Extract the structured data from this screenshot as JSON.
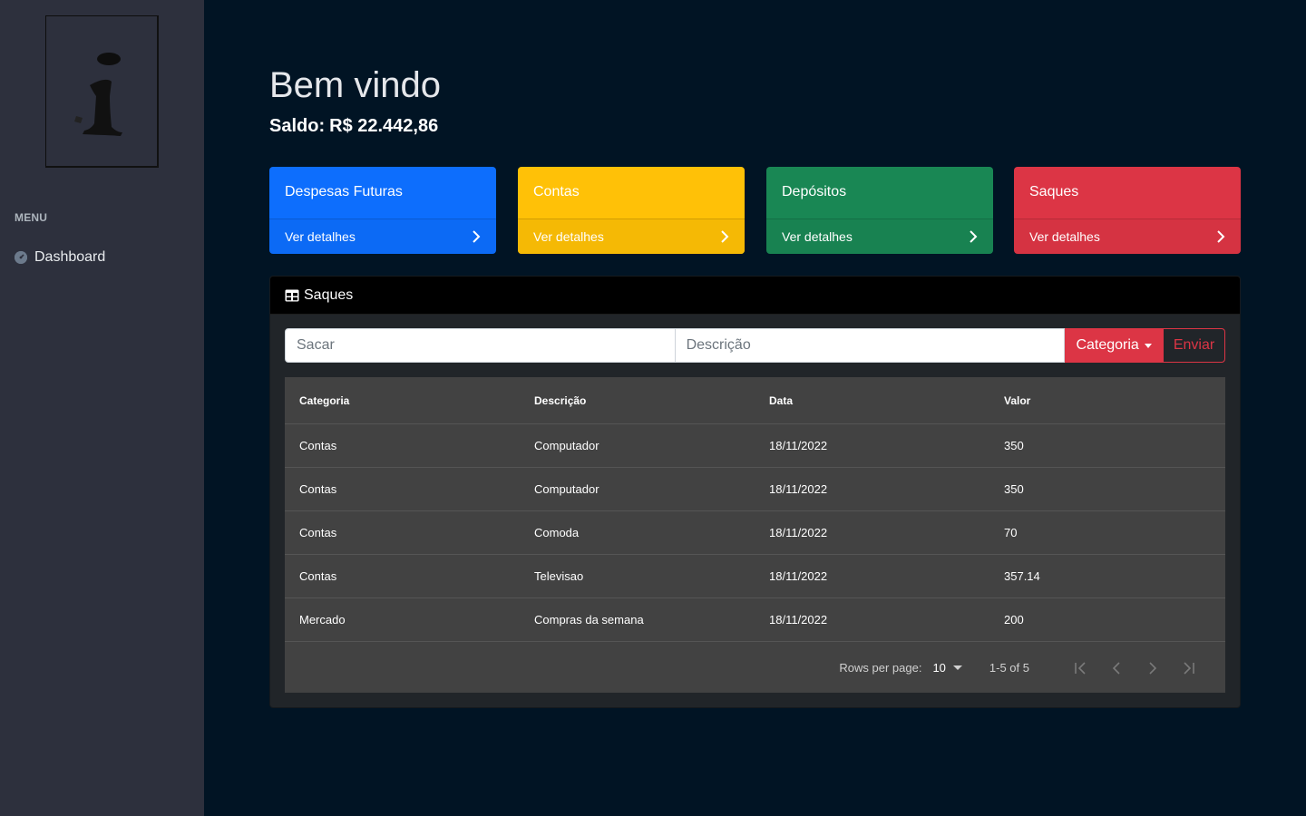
{
  "sidebar": {
    "menu_heading": "MENU",
    "items": [
      {
        "label": "Dashboard",
        "icon": "dashboard-icon"
      }
    ]
  },
  "header": {
    "title": "Bem vindo",
    "balance_label": "Saldo:",
    "balance_value": "R$ 22.442,86"
  },
  "cards": [
    {
      "title": "Despesas Futuras",
      "link": "Ver detalhes",
      "color": "#0d6efd"
    },
    {
      "title": "Contas",
      "link": "Ver detalhes",
      "color": "#ffc107"
    },
    {
      "title": "Depósitos",
      "link": "Ver detalhes",
      "color": "#198754"
    },
    {
      "title": "Saques",
      "link": "Ver detalhes",
      "color": "#dc3545"
    }
  ],
  "panel": {
    "title": "Saques",
    "icon": "table-icon",
    "form": {
      "sacar_placeholder": "Sacar",
      "sacar_value": "",
      "descricao_placeholder": "Descrição",
      "descricao_value": "",
      "category_button": "Categoria",
      "submit_button": "Enviar"
    },
    "table": {
      "columns": [
        "Categoria",
        "Descrição",
        "Data",
        "Valor"
      ],
      "rows": [
        [
          "Contas",
          "Computador",
          "18/11/2022",
          "350"
        ],
        [
          "Contas",
          "Computador",
          "18/11/2022",
          "350"
        ],
        [
          "Contas",
          "Comoda",
          "18/11/2022",
          "70"
        ],
        [
          "Contas",
          "Televisao",
          "18/11/2022",
          "357.14"
        ],
        [
          "Mercado",
          "Compras da semana",
          "18/11/2022",
          "200"
        ]
      ]
    },
    "pagination": {
      "rows_per_page_label": "Rows per page:",
      "rows_per_page_value": "10",
      "range": "1-5 of 5"
    }
  },
  "colors": {
    "background": "#011424",
    "sidebar": "#2d303d",
    "table": "#424242",
    "danger": "#dc3545"
  }
}
